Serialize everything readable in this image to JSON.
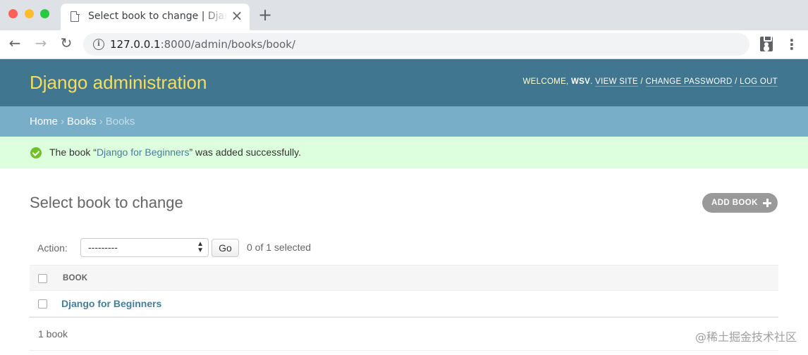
{
  "browser": {
    "tab_title": "Select book to change | Django site admin",
    "tab_close": "×",
    "new_tab": "+",
    "url_host": "127.0.0.1",
    "url_rest": ":8000/admin/books/book/",
    "menu_glyph": "⋮",
    "info_glyph": "i",
    "back_glyph": "←",
    "forward_glyph": "→",
    "reload_glyph": "↻"
  },
  "header": {
    "branding": "Django administration",
    "welcome": "WELCOME, ",
    "username": "WSV",
    "view_site": "VIEW SITE",
    "change_password": "CHANGE PASSWORD",
    "log_out": "LOG OUT",
    "sep1": ". ",
    "sep2": " / ",
    "sep3": " / "
  },
  "breadcrumbs": {
    "home": "Home",
    "app": "Books",
    "current": "Books",
    "separator": "›"
  },
  "message": {
    "prefix": "The book “",
    "link": "Django for Beginners",
    "suffix": "” was added successfully."
  },
  "content": {
    "title": "Select book to change",
    "add_button": "ADD BOOK"
  },
  "actions": {
    "label": "Action:",
    "selected_option": "---------",
    "go_label": "Go",
    "counter": "0 of 1 selected"
  },
  "table": {
    "column_header": "BOOK",
    "rows": [
      {
        "title": "Django for Beginners"
      }
    ]
  },
  "paginator": {
    "text": "1 book"
  },
  "watermark": "@稀土掘金技术社区",
  "colors": {
    "header_bg": "#417690",
    "branding": "#f5dd5d",
    "breadcrumbs_bg": "#79aec8",
    "success_bg": "#ddffdd",
    "link": "#447e9b"
  }
}
